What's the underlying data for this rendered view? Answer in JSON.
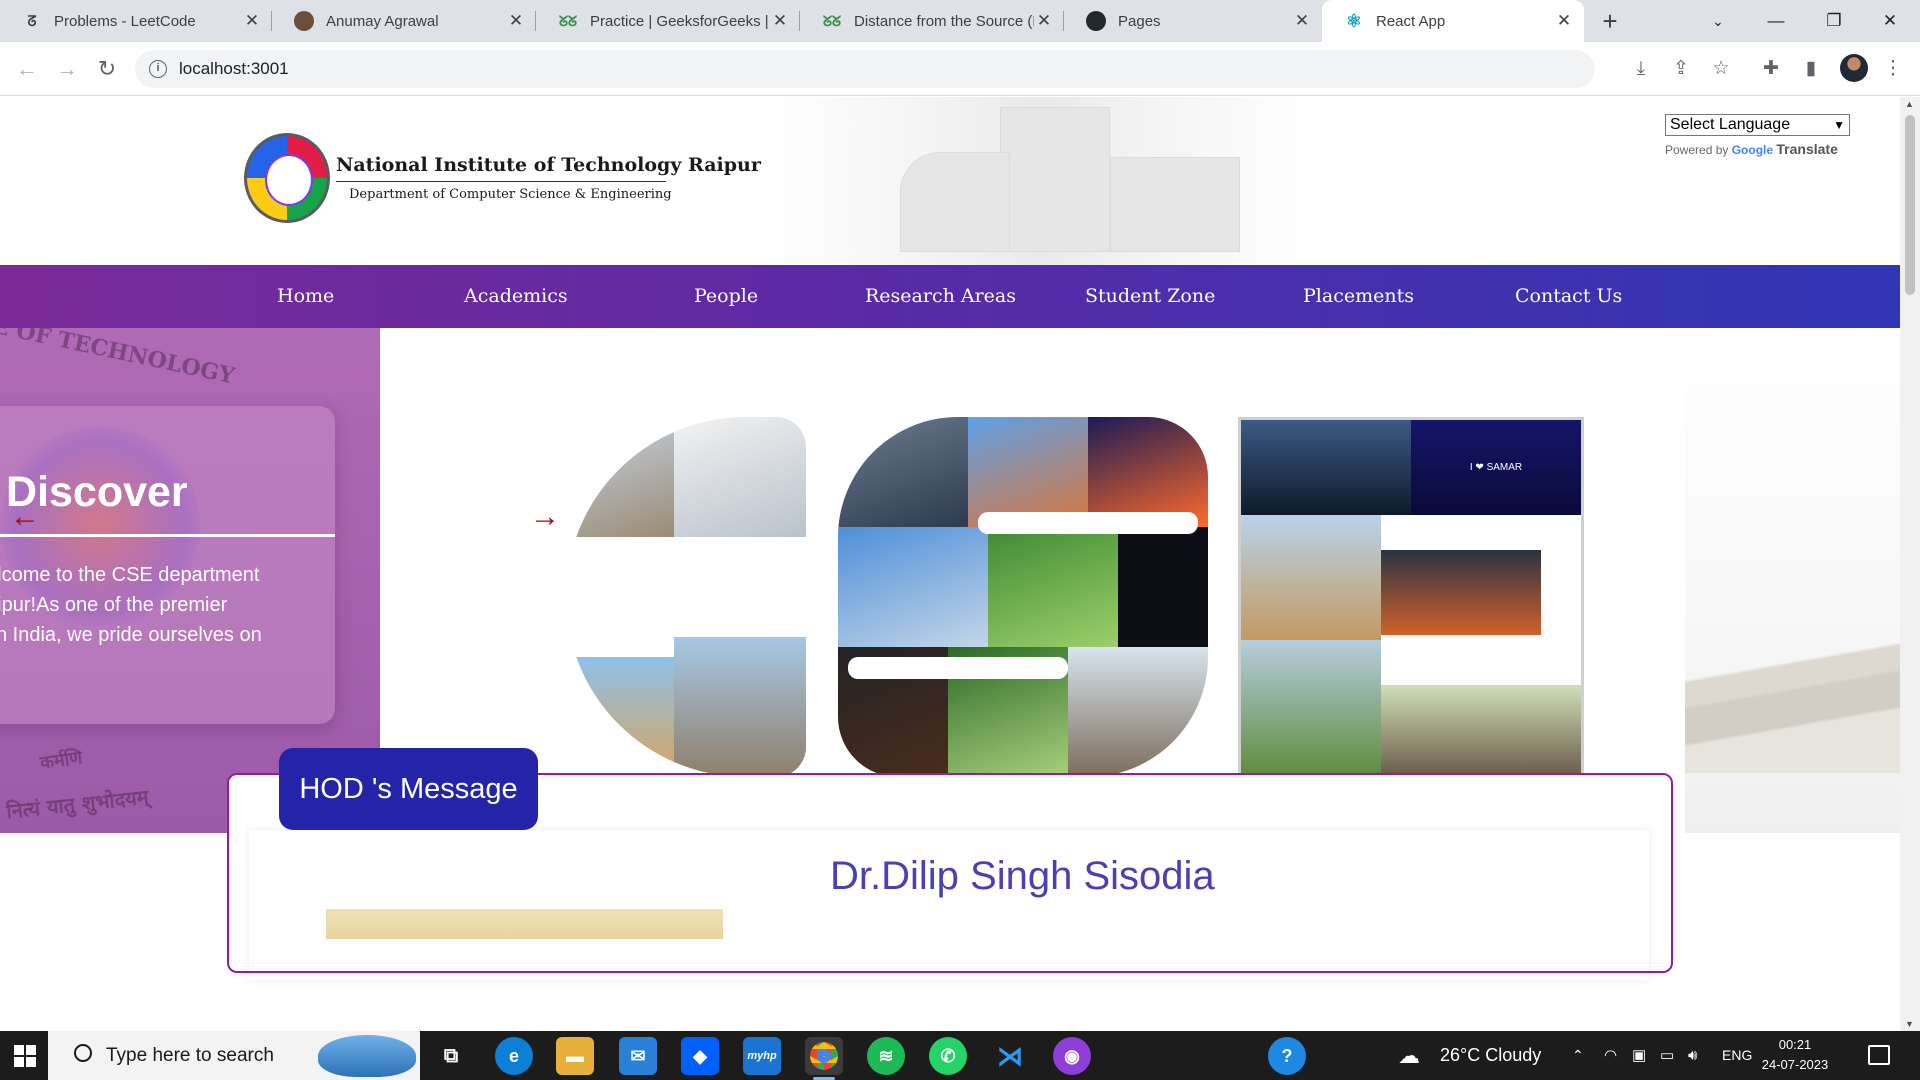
{
  "browser": {
    "tabs": [
      {
        "title": "Problems - LeetCode",
        "icon": "leetcode-icon"
      },
      {
        "title": "Anumay Agrawal",
        "icon": "profile-icon"
      },
      {
        "title": "Practice | GeeksforGeeks | A",
        "icon": "geeksforgeeks-icon"
      },
      {
        "title": "Distance from the Source (B",
        "icon": "geeksforgeeks-icon"
      },
      {
        "title": "Pages",
        "icon": "github-icon"
      },
      {
        "title": "React App",
        "icon": "react-icon"
      }
    ],
    "url": "localhost:3001"
  },
  "header": {
    "institute_name": "National Institute of Technology Raipur",
    "department": "Department of Computer Science & Engineering",
    "language_select": "Select Language",
    "powered_by": "Powered by",
    "google": "Google",
    "translate": "Translate"
  },
  "nav": {
    "items": [
      "Home",
      "Academics",
      "People",
      "Research Areas",
      "Student Zone",
      "Placements",
      "Contact Us"
    ]
  },
  "hero": {
    "heading": "Discover",
    "text": "elcome to the CSE department\naipur!As one of the premier\n in India, we pride ourselves on",
    "seal_text_1": "E OF TECHNOLOGY",
    "seal_text_2": "कर्मणि",
    "seal_text_3": "नित्यं यातु शुभोदयम्",
    "samar_label": "I ❤ SAMAR"
  },
  "hod": {
    "tab_label": "HOD 's Message",
    "name": "Dr.Dilip Singh Sisodia"
  },
  "taskbar": {
    "search_placeholder": "Type here to search",
    "weather": "26°C  Cloudy",
    "language": "ENG",
    "time": "00:21",
    "date": "24-07-2023"
  },
  "colors": {
    "nav_start": "#7b2b98",
    "nav_end": "#2f36b5",
    "hod_tab": "#2424a8",
    "hod_name": "#4b3fb3",
    "arrow": "#b30000"
  }
}
